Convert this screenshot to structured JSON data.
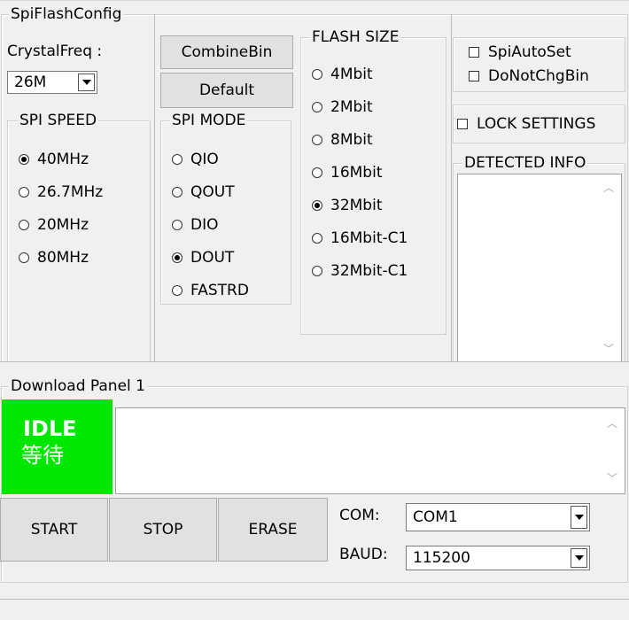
{
  "spi_flash_config": {
    "title": "SpiFlashConfig",
    "crystal_freq_label": "CrystalFreq :",
    "crystal_freq_value": "26M",
    "combine_bin_label": "CombineBin",
    "default_label": "Default",
    "spi_speed": {
      "title": "SPI SPEED",
      "options": [
        "40MHz",
        "26.7MHz",
        "20MHz",
        "80MHz"
      ],
      "selected": "40MHz"
    },
    "spi_mode": {
      "title": "SPI MODE",
      "options": [
        "QIO",
        "QOUT",
        "DIO",
        "DOUT",
        "FASTRD"
      ],
      "selected": "DOUT"
    },
    "flash_size": {
      "title": "FLASH SIZE",
      "options": [
        "4Mbit",
        "2Mbit",
        "8Mbit",
        "16Mbit",
        "32Mbit",
        "16Mbit-C1",
        "32Mbit-C1"
      ],
      "selected": "32Mbit"
    },
    "spi_auto_set_label": "SpiAutoSet",
    "do_not_chg_bin_label": "DoNotChgBin",
    "lock_settings_label": "LOCK SETTINGS",
    "detected_info_title": "DETECTED INFO"
  },
  "download_panel": {
    "title": "Download Panel 1",
    "status_en": "IDLE",
    "status_cn": "等待",
    "status_color": "#00e600",
    "start_label": "START",
    "stop_label": "STOP",
    "erase_label": "ERASE",
    "com_label": "COM:",
    "com_value": "COM1",
    "baud_label": "BAUD:",
    "baud_value": "115200"
  }
}
